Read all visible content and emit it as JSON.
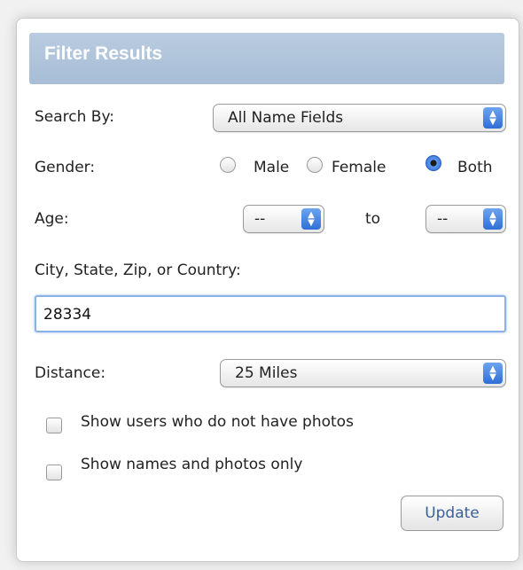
{
  "panel": {
    "title": "Filter Results"
  },
  "search_by": {
    "label": "Search By:",
    "selected": "All Name Fields"
  },
  "gender": {
    "label": "Gender:",
    "options": [
      "Male",
      "Female",
      "Both"
    ],
    "selected": "Both"
  },
  "age": {
    "label": "Age:",
    "from": "--",
    "separator": "to",
    "to": "--"
  },
  "location": {
    "label": "City, State, Zip, or Country:",
    "value": "28334"
  },
  "distance": {
    "label": "Distance:",
    "selected": "25 Miles"
  },
  "options": {
    "no_photos_label": "Show users who do not have photos",
    "names_photos_label": "Show names and photos only"
  },
  "actions": {
    "update_label": "Update"
  },
  "colors": {
    "header": "#a7bdd6",
    "accent": "#2f6fd6",
    "focus": "#8ab2e8"
  },
  "icons": {
    "select_arrow": "updown-chevron-icon"
  }
}
